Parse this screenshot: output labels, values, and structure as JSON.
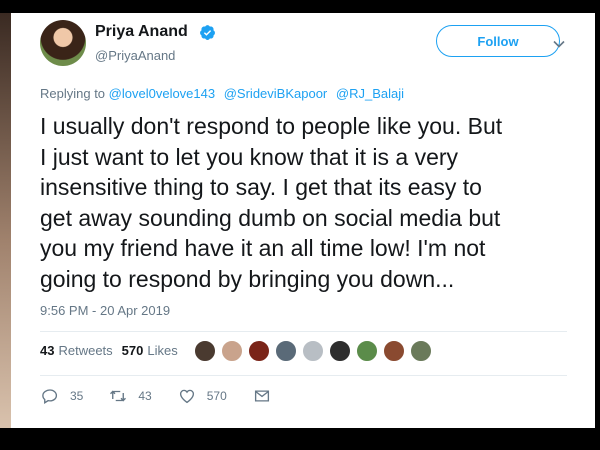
{
  "user": {
    "display_name": "Priya Anand",
    "handle": "@PriyaAnand",
    "verified_icon": "verified-badge-icon"
  },
  "header": {
    "follow_label": "Follow",
    "menu_icon": "chevron-down-icon"
  },
  "reply": {
    "prefix": "Replying to",
    "mentions": [
      "@lovel0velove143",
      "@SrideviBKapoor",
      "@RJ_Balaji"
    ]
  },
  "tweet": {
    "lines": [
      "I usually don't respond to people like you. But",
      "I just want to let you know that it is a very",
      "insensitive thing to say. I get that its easy to",
      "get away sounding dumb on social media but",
      "you my friend have it an all time low! I'm not",
      "going to respond by bringing you down..."
    ],
    "timestamp": "9:56 PM - 20 Apr 2019"
  },
  "stats": {
    "retweets_count": "43",
    "retweets_label": "Retweets",
    "likes_count": "570",
    "likes_label": "Likes"
  },
  "likers": [
    {
      "color": "#4a3a30"
    },
    {
      "color": "#c9a38c"
    },
    {
      "color": "#7a2418"
    },
    {
      "color": "#5a6a78"
    },
    {
      "color": "#b8bec4"
    },
    {
      "color": "#2e2e2e"
    },
    {
      "color": "#5b8c4a"
    },
    {
      "color": "#8a4a30"
    },
    {
      "color": "#6a7a5a"
    }
  ],
  "actions": {
    "reply_count": "35",
    "retweet_count": "43",
    "like_count": "570",
    "icons": [
      "reply-icon",
      "retweet-icon",
      "like-icon",
      "message-icon"
    ]
  },
  "colors": {
    "accent": "#1da1f2",
    "secondary_text": "#657786",
    "primary_text": "#14171a"
  }
}
